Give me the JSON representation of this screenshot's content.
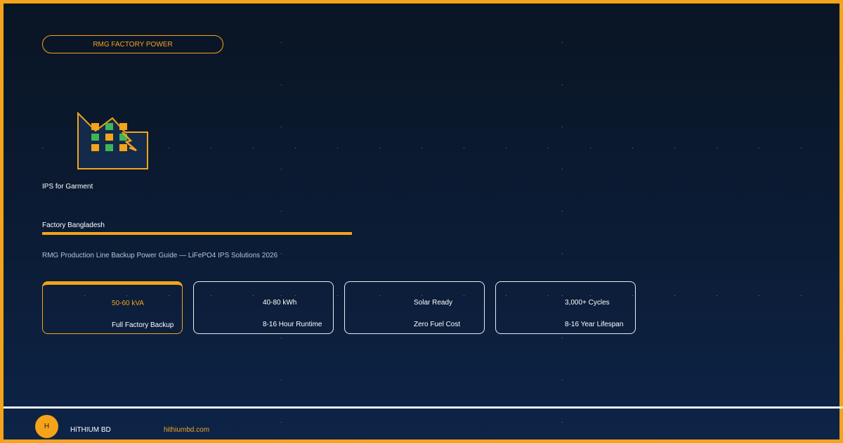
{
  "badge": {
    "label": "RMG FACTORY POWER"
  },
  "heading": {
    "line1": "IPS for Garment",
    "line2": "Factory Bangladesh"
  },
  "subtitle": "RMG Production Line Backup Power Guide — LiFePO4 IPS Solutions 2026",
  "stats": [
    {
      "value": "50-60 kVA",
      "label": "Full Factory Backup"
    },
    {
      "value": "40-80 kWh",
      "label": "8-16 Hour Runtime"
    },
    {
      "value": "Solar Ready",
      "label": "Zero Fuel Cost"
    },
    {
      "value": "3,000+ Cycles",
      "label": "8-16 Year Lifespan"
    }
  ],
  "footer": {
    "logo_letter": "H",
    "brand": "HiTHIUM BD",
    "website": "hithiumbd.com"
  },
  "colors": {
    "accent": "#f5a31a",
    "green": "#3fb55a",
    "background": "#0b1c35"
  },
  "icons": [
    "factory-icon",
    "lightning-bolt-icon"
  ]
}
